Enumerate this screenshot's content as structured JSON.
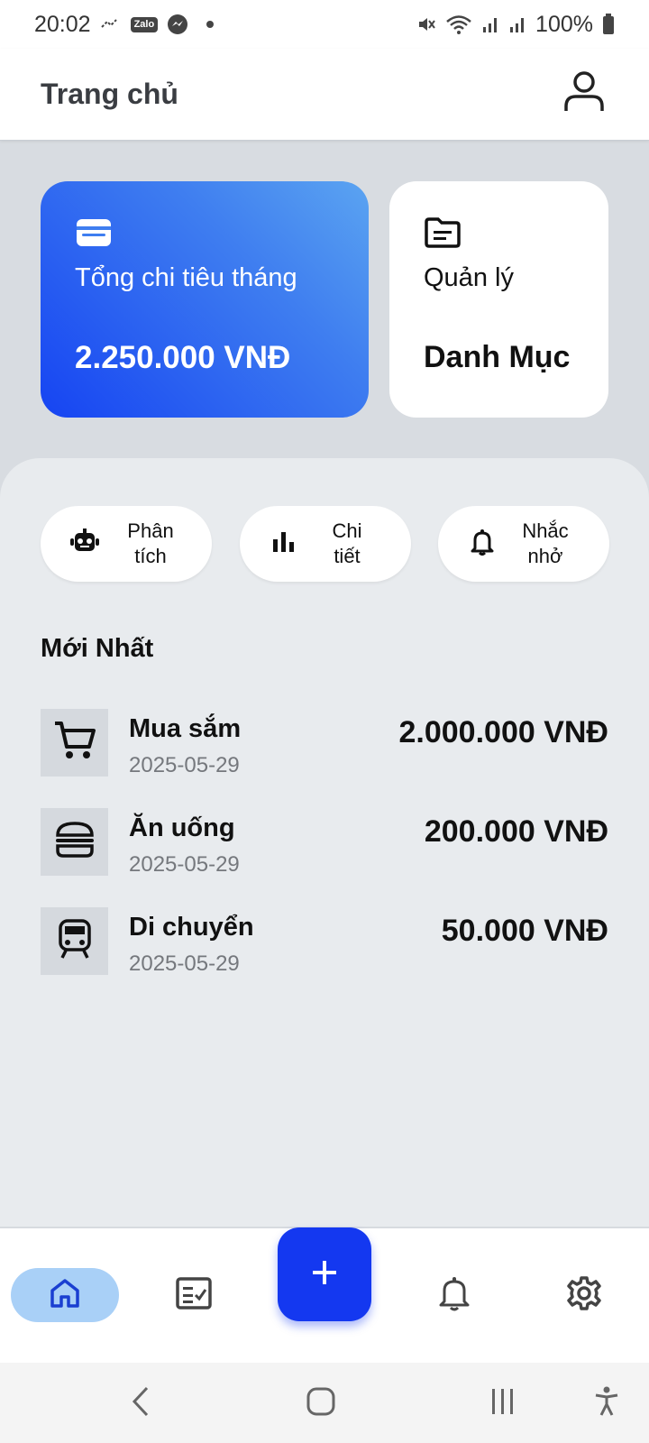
{
  "status_bar": {
    "time": "20:02",
    "zalo_label": "Zalo",
    "battery": "100%"
  },
  "header": {
    "title": "Trang chủ"
  },
  "cards": {
    "spend": {
      "label": "Tổng chi tiêu tháng",
      "amount": "2.250.000 VNĐ",
      "gradient_colors": [
        "#5ba4f1",
        "#1644f2"
      ]
    },
    "category": {
      "label": "Quản lý",
      "title": "Danh Mục"
    }
  },
  "chips": [
    {
      "label_line1": "Phân",
      "label_line2": "tích",
      "icon": "robot-icon"
    },
    {
      "label_line1": "Chi",
      "label_line2": "tiết",
      "icon": "bar-chart-icon"
    },
    {
      "label_line1": "Nhắc",
      "label_line2": "nhở",
      "icon": "bell-icon"
    }
  ],
  "latest": {
    "title": "Mới Nhất",
    "transactions": [
      {
        "name": "Mua sắm",
        "date": "2025-05-29",
        "amount": "2.000.000 VNĐ",
        "icon": "shopping-cart-icon"
      },
      {
        "name": "Ăn uống",
        "date": "2025-05-29",
        "amount": "200.000 VNĐ",
        "icon": "burger-icon"
      },
      {
        "name": "Di chuyển",
        "date": "2025-05-29",
        "amount": "50.000 VNĐ",
        "icon": "train-icon"
      }
    ]
  },
  "bottom_nav": {
    "items": [
      "home-icon",
      "checklist-icon",
      "add-icon",
      "bell-icon",
      "gear-icon"
    ],
    "active": "home-icon",
    "fab_label": "+"
  },
  "colors": {
    "accent": "#1438f0",
    "active_nav_bg": "#a9d0f7",
    "background": "#d8dce1",
    "panel": "#e8ebee"
  }
}
